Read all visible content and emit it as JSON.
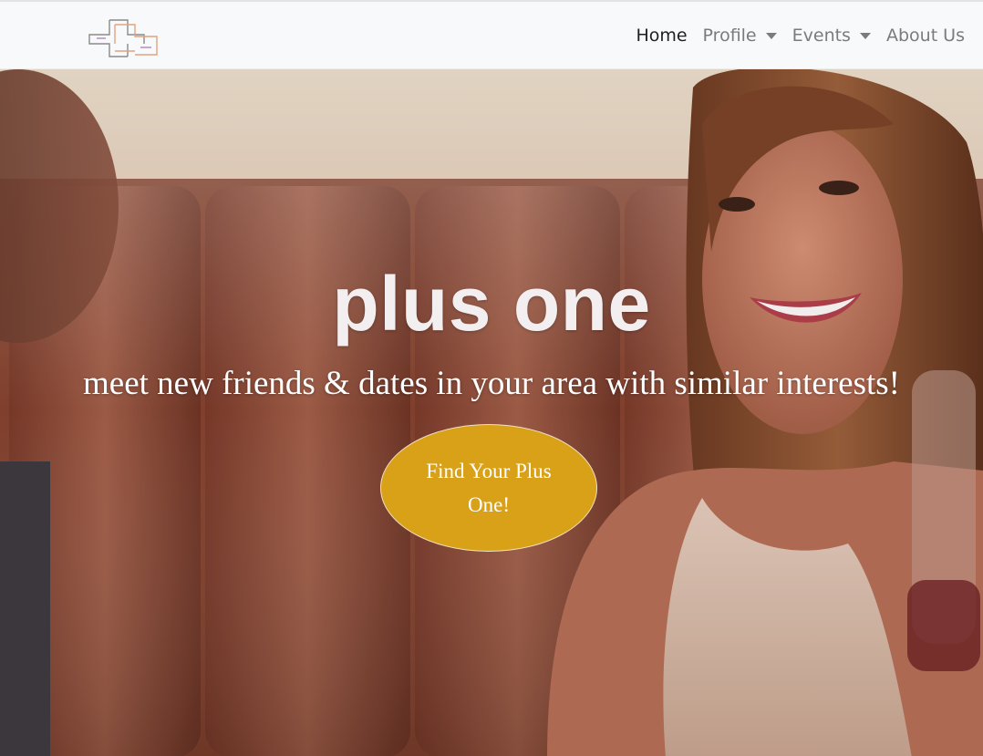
{
  "navbar": {
    "brand_logo_icon": "plus-one-logo-icon",
    "links": [
      {
        "label": "Home",
        "active": true,
        "dropdown": false
      },
      {
        "label": "Profile",
        "active": false,
        "dropdown": true
      },
      {
        "label": "Events",
        "active": false,
        "dropdown": true
      },
      {
        "label": "About Us",
        "active": false,
        "dropdown": false
      }
    ]
  },
  "hero": {
    "title": "plus one",
    "subtitle": "meet new friends & dates in your area with similar interests!",
    "cta_label": "Find Your Plus One!"
  },
  "colors": {
    "cta_background": "#d9a118",
    "navbar_background": "#f8f9fa",
    "nav_active": "#1f1f1f",
    "nav_inactive": "#7b7b7b"
  }
}
